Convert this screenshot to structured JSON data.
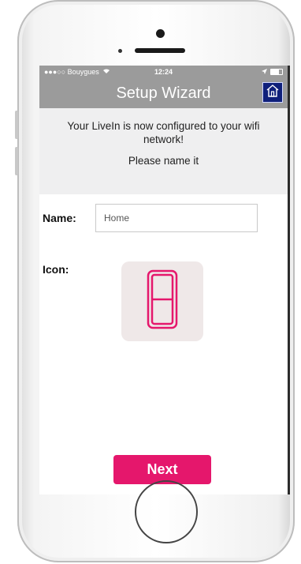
{
  "statusbar": {
    "carrier": "●●●○○ Bouygues",
    "time": "12:24"
  },
  "navbar": {
    "title": "Setup Wizard"
  },
  "info": {
    "message": "Your LiveIn is now configured to your wifi network!",
    "prompt": "Please name it"
  },
  "form": {
    "name_label": "Name:",
    "name_value": "Home",
    "icon_label": "Icon:"
  },
  "actions": {
    "next_label": "Next"
  },
  "colors": {
    "accent": "#e5176c",
    "navbar": "#9b9b9b",
    "home_button": "#0f1f7a",
    "icon_tile": "#efe8e8"
  },
  "icons": {
    "home": "home-icon",
    "door": "door-icon",
    "wifi": "wifi-icon",
    "battery": "battery-icon"
  }
}
